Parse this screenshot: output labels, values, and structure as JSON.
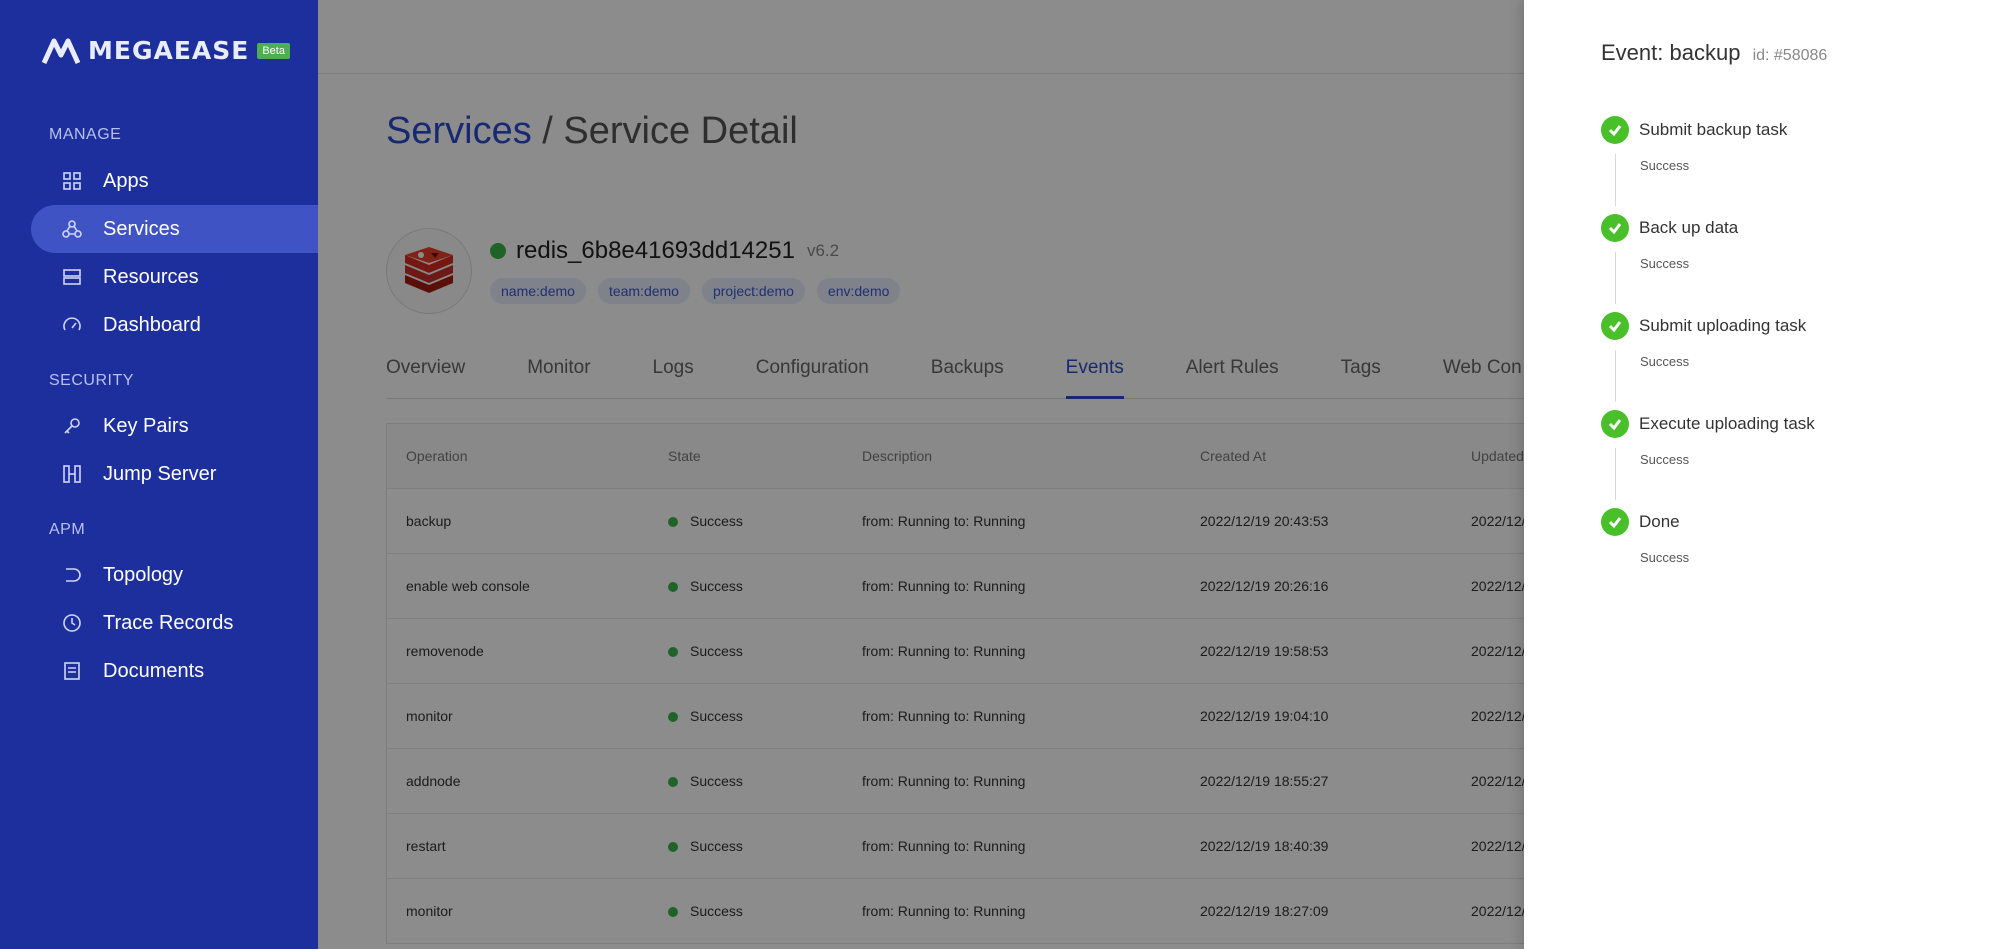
{
  "brand": {
    "name": "MEGAEASE",
    "badge": "Beta"
  },
  "sidebar": {
    "sections": [
      {
        "title": "MANAGE"
      },
      {
        "title": "SECURITY"
      },
      {
        "title": "APM"
      }
    ],
    "items": [
      {
        "label": "Apps",
        "icon": "apps-grid-icon"
      },
      {
        "label": "Services",
        "icon": "services-icon",
        "active": true
      },
      {
        "label": "Resources",
        "icon": "resources-icon"
      },
      {
        "label": "Dashboard",
        "icon": "dashboard-gauge-icon"
      },
      {
        "label": "Key Pairs",
        "icon": "key-icon"
      },
      {
        "label": "Jump Server",
        "icon": "jump-server-icon"
      },
      {
        "label": "Topology",
        "icon": "topology-icon"
      },
      {
        "label": "Trace Records",
        "icon": "clock-icon"
      },
      {
        "label": "Documents",
        "icon": "document-icon"
      }
    ]
  },
  "breadcrumb": {
    "link": "Services",
    "separator": "/",
    "current": "Service Detail"
  },
  "service": {
    "name": "redis_6b8e41693dd14251",
    "version": "v6.2",
    "status_color": "#3ab54a",
    "tags": [
      "name:demo",
      "team:demo",
      "project:demo",
      "env:demo"
    ]
  },
  "tabs": [
    "Overview",
    "Monitor",
    "Logs",
    "Configuration",
    "Backups",
    "Events",
    "Alert Rules",
    "Tags",
    "Web Con"
  ],
  "active_tab": "Events",
  "table": {
    "headers": [
      "Operation",
      "State",
      "Description",
      "Created At",
      "Updated"
    ],
    "rows": [
      {
        "op": "backup",
        "state": "Success",
        "desc": "from: Running to: Running",
        "created": "2022/12/19 20:43:53",
        "updated": "2022/12/"
      },
      {
        "op": "enable web console",
        "state": "Success",
        "desc": "from: Running to: Running",
        "created": "2022/12/19 20:26:16",
        "updated": "2022/12/"
      },
      {
        "op": "removenode",
        "state": "Success",
        "desc": "from: Running to: Running",
        "created": "2022/12/19 19:58:53",
        "updated": "2022/12/"
      },
      {
        "op": "monitor",
        "state": "Success",
        "desc": "from: Running to: Running",
        "created": "2022/12/19 19:04:10",
        "updated": "2022/12/"
      },
      {
        "op": "addnode",
        "state": "Success",
        "desc": "from: Running to: Running",
        "created": "2022/12/19 18:55:27",
        "updated": "2022/12/"
      },
      {
        "op": "restart",
        "state": "Success",
        "desc": "from: Running to: Running",
        "created": "2022/12/19 18:40:39",
        "updated": "2022/12/"
      },
      {
        "op": "monitor",
        "state": "Success",
        "desc": "from: Running to: Running",
        "created": "2022/12/19 18:27:09",
        "updated": "2022/12/"
      }
    ]
  },
  "drawer": {
    "title": "Event: backup",
    "id": "id: #58086",
    "steps": [
      {
        "title": "Submit backup task",
        "status": "Success"
      },
      {
        "title": "Back up data",
        "status": "Success"
      },
      {
        "title": "Submit uploading task",
        "status": "Success"
      },
      {
        "title": "Execute uploading task",
        "status": "Success"
      },
      {
        "title": "Done",
        "status": "Success"
      }
    ],
    "success_color": "#49c02a"
  },
  "colors": {
    "sidebar": "#1d2f9c",
    "accent": "#2b4ccc",
    "active_item": "#3f53c4"
  }
}
